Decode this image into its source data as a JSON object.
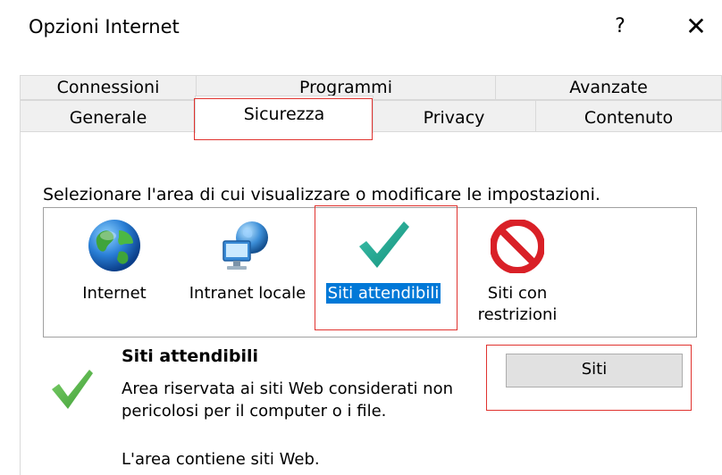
{
  "window": {
    "title": "Opzioni Internet",
    "help_label": "?",
    "close_label": "✕"
  },
  "tabs": {
    "row1": [
      {
        "label": "Connessioni"
      },
      {
        "label": "Programmi"
      },
      {
        "label": "Avanzate"
      }
    ],
    "row2": [
      {
        "label": "Generale"
      },
      {
        "label": "Sicurezza",
        "active": true
      },
      {
        "label": "Privacy"
      },
      {
        "label": "Contenuto"
      }
    ]
  },
  "security": {
    "instruction": "Selezionare l'area di cui visualizzare o modificare le impostazioni.",
    "zones": [
      {
        "label": "Internet",
        "icon": "globe-icon"
      },
      {
        "label": "Intranet locale",
        "icon": "network-icon"
      },
      {
        "label": "Siti attendibili",
        "icon": "checkmark-icon",
        "selected": true
      },
      {
        "label_line1": "Siti con",
        "label_line2": "restrizioni",
        "icon": "restricted-icon"
      }
    ],
    "selected_zone": {
      "title": "Siti attendibili",
      "description": "Area riservata ai siti Web considerati non pericolosi per il computer o i file.",
      "status": "L'area contiene siti Web.",
      "sites_button": "Siti"
    }
  },
  "colors": {
    "selection": "#0078d7",
    "highlight_box": "#e0332f",
    "check_teal": "#19a38d",
    "check_green": "#5ab64a",
    "restricted_red": "#d92027"
  }
}
